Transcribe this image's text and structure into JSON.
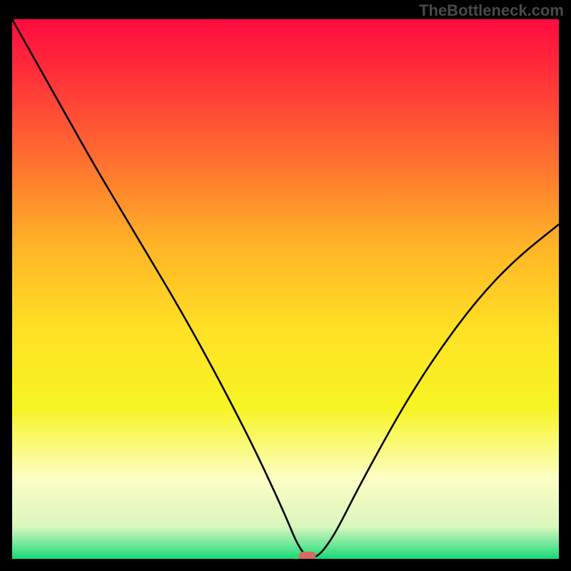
{
  "watermark": "TheBottleneck.com",
  "chart_data": {
    "type": "line",
    "title": "",
    "xlabel": "",
    "ylabel": "",
    "xlim": [
      0,
      100
    ],
    "ylim": [
      0,
      100
    ],
    "x_at_min": 54,
    "marker": {
      "x": 54,
      "y": 0,
      "color": "#d66b5f"
    },
    "series": [
      {
        "name": "bottleneck-curve",
        "x": [
          0,
          5,
          10,
          15,
          20,
          25,
          30,
          35,
          40,
          45,
          50,
          52,
          54,
          56,
          58,
          60,
          63,
          67,
          72,
          78,
          85,
          92,
          100
        ],
        "values": [
          100,
          91,
          82,
          73,
          64.5,
          56,
          47.5,
          38.5,
          29,
          19,
          8,
          3,
          0,
          0.5,
          3,
          6.5,
          12.5,
          20,
          29,
          38.5,
          48,
          55.5,
          62
        ]
      }
    ],
    "gradient_stops": [
      {
        "offset": 0,
        "color": "#ff0b3f"
      },
      {
        "offset": 0.1,
        "color": "#ff2f3a"
      },
      {
        "offset": 0.25,
        "color": "#ff6b30"
      },
      {
        "offset": 0.42,
        "color": "#ffb427"
      },
      {
        "offset": 0.58,
        "color": "#ffe224"
      },
      {
        "offset": 0.72,
        "color": "#f6f423"
      },
      {
        "offset": 0.85,
        "color": "#fdfec4"
      },
      {
        "offset": 0.94,
        "color": "#d9f6bd"
      },
      {
        "offset": 0.975,
        "color": "#6be697"
      },
      {
        "offset": 1.0,
        "color": "#17d877"
      }
    ]
  }
}
